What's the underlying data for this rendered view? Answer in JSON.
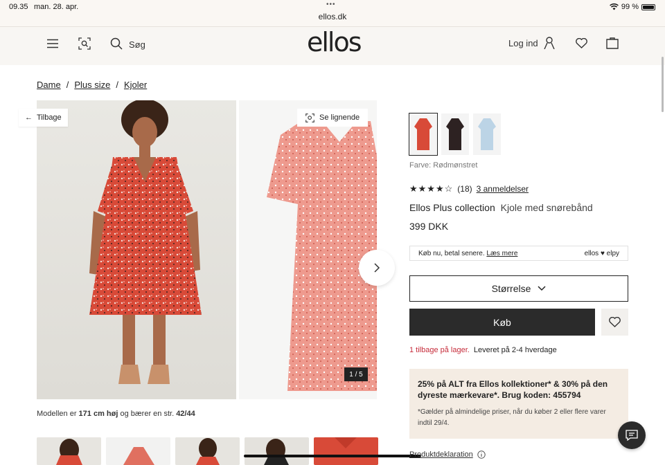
{
  "status_bar": {
    "time": "09.35",
    "date": "man. 28. apr.",
    "url": "ellos.dk",
    "battery": "99 %"
  },
  "header": {
    "search_label": "Søg",
    "logo": "ellos",
    "login_label": "Log ind"
  },
  "breadcrumb": {
    "items": [
      "Dame",
      "Plus size",
      "Kjoler"
    ]
  },
  "gallery": {
    "back_label": "Tilbage",
    "similar_label": "Se lignende",
    "counter": "1 / 5"
  },
  "model_info": {
    "prefix": "Modellen er",
    "height": "171 cm høj",
    "middle": "og bærer en str.",
    "size": "42/44"
  },
  "product": {
    "color_label": "Farve: Rødmønstret",
    "stars": "★★★★☆",
    "rating_count": "(18)",
    "reviews_link": "3 anmeldelser",
    "brand": "Ellos Plus collection",
    "name": "Kjole med snørebånd",
    "price": "399 DKK"
  },
  "payment": {
    "text": "Køb nu, betal senere.",
    "link": "Læs mere",
    "partner": "ellos ♥ elpy"
  },
  "actions": {
    "size_label": "Størrelse",
    "buy_label": "Køb"
  },
  "stock": {
    "left": "1 tilbage på lager.",
    "delivery": "Leveret på 2-4 hverdage"
  },
  "promo": {
    "main": "25% på ALT fra Ellos kollektioner* & 30% på den dyreste mærkevare*. Brug koden: 455794",
    "note": "*Gælder på almindelige priser, når du køber 2 eller flere varer indtil 29/4."
  },
  "footer": {
    "declaration": "Produktdeklaration"
  },
  "colors": {
    "dress": "#d84a38",
    "accent_red": "#c62b3a",
    "dark": "#2b2b2b"
  }
}
